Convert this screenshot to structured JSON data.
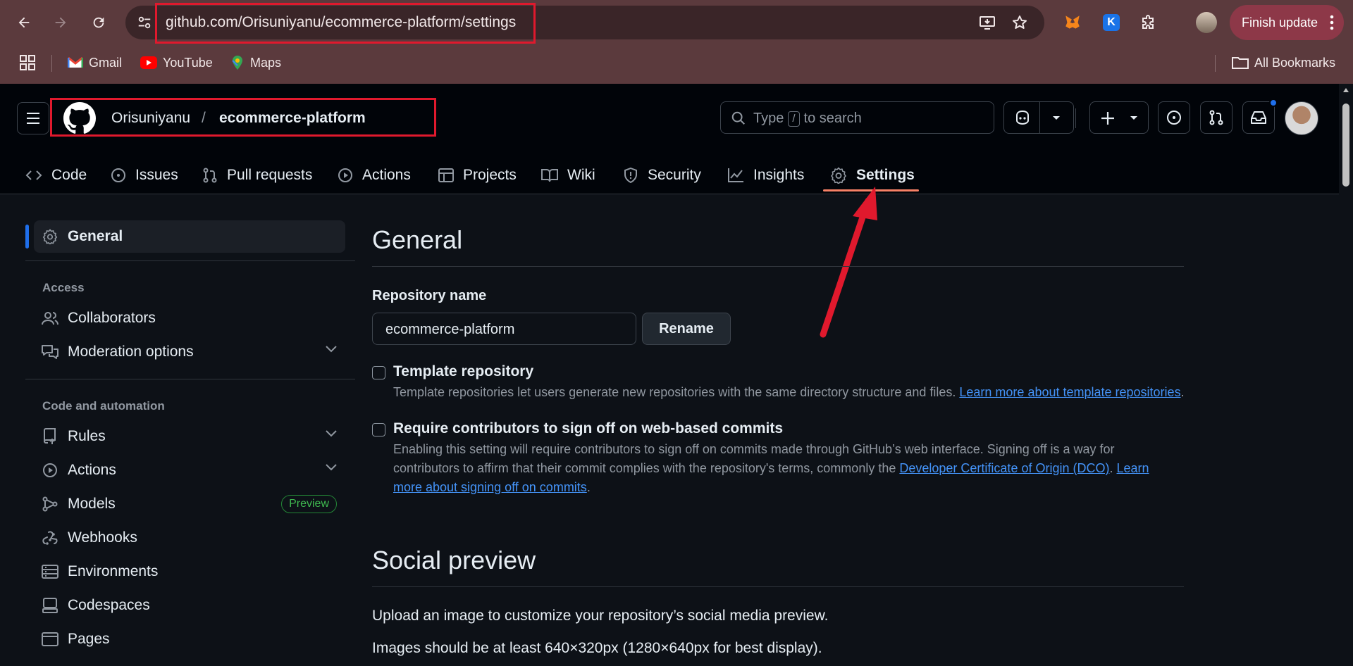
{
  "browser": {
    "url": "github.com/Orisuniyanu/ecommerce-platform/settings",
    "finish_update": "Finish update",
    "bookmarks": [
      {
        "label": "Gmail",
        "icon": "gmail-icon"
      },
      {
        "label": "YouTube",
        "icon": "youtube-icon"
      },
      {
        "label": "Maps",
        "icon": "maps-icon"
      }
    ],
    "all_bookmarks": "All Bookmarks"
  },
  "header": {
    "owner": "Orisuniyanu",
    "separator": "/",
    "repo": "ecommerce-platform",
    "search_prefix": "Type",
    "search_key": "/",
    "search_suffix": "to search"
  },
  "tabs": [
    {
      "label": "Code",
      "icon": "code-icon"
    },
    {
      "label": "Issues",
      "icon": "issue-icon"
    },
    {
      "label": "Pull requests",
      "icon": "pull-request-icon"
    },
    {
      "label": "Actions",
      "icon": "play-icon"
    },
    {
      "label": "Projects",
      "icon": "table-icon"
    },
    {
      "label": "Wiki",
      "icon": "book-icon"
    },
    {
      "label": "Security",
      "icon": "shield-icon"
    },
    {
      "label": "Insights",
      "icon": "graph-icon"
    },
    {
      "label": "Settings",
      "icon": "gear-icon",
      "active": true
    }
  ],
  "sidebar": {
    "general": "General",
    "access_heading": "Access",
    "collaborators": "Collaborators",
    "moderation": "Moderation options",
    "code_heading": "Code and automation",
    "rules": "Rules",
    "actions": "Actions",
    "models": "Models",
    "preview_badge": "Preview",
    "webhooks": "Webhooks",
    "environments": "Environments",
    "codespaces": "Codespaces",
    "pages": "Pages"
  },
  "main": {
    "title": "General",
    "repo_name_label": "Repository name",
    "repo_name_value": "ecommerce-platform",
    "rename_button": "Rename",
    "template": {
      "title": "Template repository",
      "desc": "Template repositories let users generate new repositories with the same directory structure and files.",
      "link": "Learn more about template repositories",
      "end": ".",
      "checked": false
    },
    "signoff": {
      "title": "Require contributors to sign off on web-based commits",
      "desc_line1": "Enabling this setting will require contributors to sign off on commits made through GitHub’s web interface. Signing off is a way for",
      "desc_line2": "contributors to affirm that their commit complies with the repository's terms, commonly the",
      "link_dco": "Developer Certificate of Origin (DCO)",
      "sep": ".",
      "link_learn_a": "Learn",
      "link_learn_b": "more about signing off on commits",
      "end": ".",
      "checked": false
    },
    "social_title": "Social preview",
    "social_desc1": "Upload an image to customize your repository’s social media preview.",
    "social_desc2": "Images should be at least 640×320px (1280×640px for best display)."
  },
  "colors": {
    "annotation": "#e0192d",
    "active_tab_underline": "#f78166",
    "link": "#4493f8",
    "chrome_bg": "#5b3a3d"
  }
}
